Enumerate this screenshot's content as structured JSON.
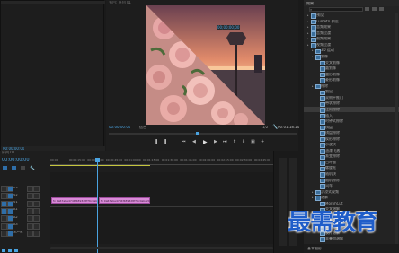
{
  "monitor": {
    "title": "节目: 序列 01",
    "timecode_left": "00:00:00:00",
    "fit": "适合",
    "ratio": "1/2",
    "timecode_right": "00:01:18:20",
    "overlay_timecode": "00;00;00;00"
  },
  "source": {
    "timecode": "00:00:00:00"
  },
  "timeline": {
    "tab": "序列 01",
    "timecode": "00:00:00:00",
    "ruler": [
      "00:00",
      "00:00:15:00",
      "00:00:30:00",
      "00:00:45:00",
      "00:01:00:00",
      "00:01:15:00",
      "00:01:30:00",
      "00:01:45:00",
      "00:02:00:00",
      "00:02:15:00",
      "00:02:30:00",
      "00:02:45:00"
    ],
    "tracks": [
      "V3",
      "V2",
      "V1",
      "A1",
      "A2",
      "A3",
      "主声道"
    ],
    "clips": [
      {
        "label": "fx 0a67abe47d4f4893d8f76c0abc24..."
      },
      {
        "label": "fx 0a67abe47d4f4893d8f76c0abc24..."
      }
    ]
  },
  "effects": {
    "title": "效果",
    "items": [
      {
        "label": "预设",
        "depth": 0
      },
      {
        "label": "Lumetri 预设",
        "depth": 0
      },
      {
        "label": "音频效果",
        "depth": 0
      },
      {
        "label": "音频过渡",
        "depth": 0
      },
      {
        "label": "视频效果",
        "depth": 0
      },
      {
        "label": "视频过渡",
        "depth": 0
      },
      {
        "label": "3D 运动",
        "depth": 1
      },
      {
        "label": "划像",
        "depth": 1
      },
      {
        "label": "交叉划像",
        "depth": 2
      },
      {
        "label": "圆划像",
        "depth": 2
      },
      {
        "label": "盒形划像",
        "depth": 2
      },
      {
        "label": "菱形划像",
        "depth": 2
      },
      {
        "label": "擦除",
        "depth": 1
      },
      {
        "label": "划出",
        "depth": 2
      },
      {
        "label": "双侧平推门",
        "depth": 2
      },
      {
        "label": "带状擦除",
        "depth": 2
      },
      {
        "label": "径向擦除",
        "depth": 2
      },
      {
        "label": "插入",
        "depth": 2
      },
      {
        "label": "时钟式擦除",
        "depth": 2
      },
      {
        "label": "棋盘",
        "depth": 2
      },
      {
        "label": "棋盘擦除",
        "depth": 2
      },
      {
        "label": "楔形擦除",
        "depth": 2
      },
      {
        "label": "水波块",
        "depth": 2
      },
      {
        "label": "油漆飞溅",
        "depth": 2
      },
      {
        "label": "渐变擦除",
        "depth": 2
      },
      {
        "label": "百叶窗",
        "depth": 2
      },
      {
        "label": "螺旋框",
        "depth": 2
      },
      {
        "label": "随机块",
        "depth": 2
      },
      {
        "label": "随机擦除",
        "depth": 2
      },
      {
        "label": "风车",
        "depth": 2
      },
      {
        "label": "沉浸式视频",
        "depth": 1
      },
      {
        "label": "溶解",
        "depth": 1
      },
      {
        "label": "MorphCut",
        "depth": 2
      },
      {
        "label": "交叉溶解",
        "depth": 2
      },
      {
        "label": "叠加溶解",
        "depth": 2
      },
      {
        "label": "渐隐为白色",
        "depth": 2
      },
      {
        "label": "渐隐为黑色",
        "depth": 2
      },
      {
        "label": "胶片溶解",
        "depth": 2
      },
      {
        "label": "非叠加溶解",
        "depth": 2
      }
    ],
    "selected_index": 16,
    "bottom_tab": "基本图形"
  },
  "watermark": "最需教育"
}
